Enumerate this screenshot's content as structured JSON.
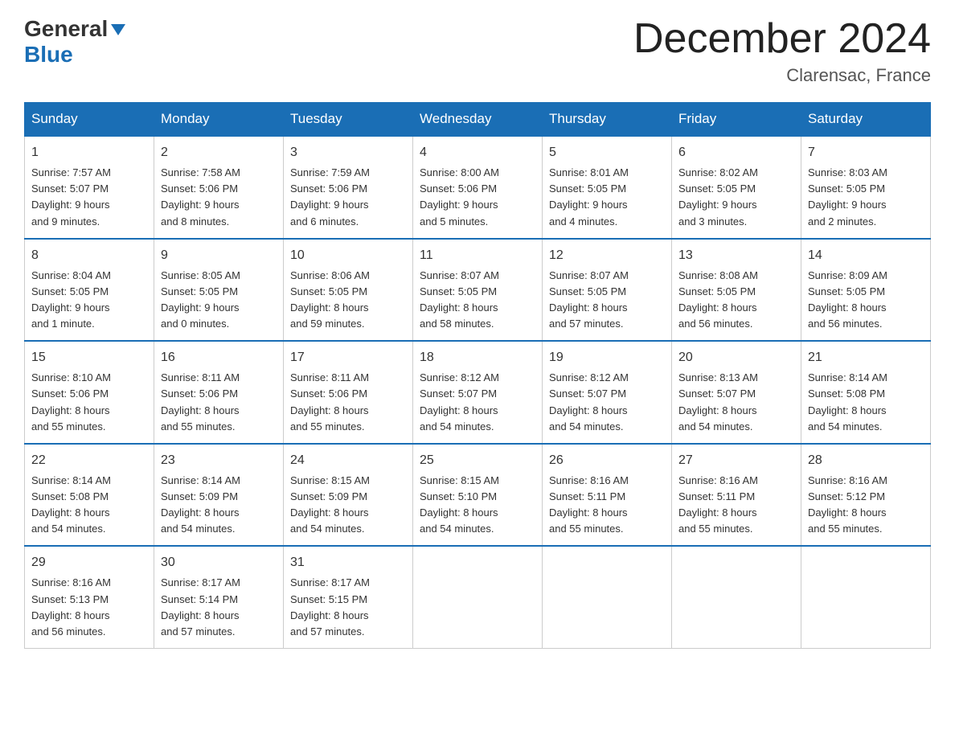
{
  "logo": {
    "general": "General",
    "blue": "Blue",
    "triangle": "▼"
  },
  "title": "December 2024",
  "location": "Clarensac, France",
  "headers": [
    "Sunday",
    "Monday",
    "Tuesday",
    "Wednesday",
    "Thursday",
    "Friday",
    "Saturday"
  ],
  "weeks": [
    [
      {
        "day": "1",
        "info": "Sunrise: 7:57 AM\nSunset: 5:07 PM\nDaylight: 9 hours\nand 9 minutes."
      },
      {
        "day": "2",
        "info": "Sunrise: 7:58 AM\nSunset: 5:06 PM\nDaylight: 9 hours\nand 8 minutes."
      },
      {
        "day": "3",
        "info": "Sunrise: 7:59 AM\nSunset: 5:06 PM\nDaylight: 9 hours\nand 6 minutes."
      },
      {
        "day": "4",
        "info": "Sunrise: 8:00 AM\nSunset: 5:06 PM\nDaylight: 9 hours\nand 5 minutes."
      },
      {
        "day": "5",
        "info": "Sunrise: 8:01 AM\nSunset: 5:05 PM\nDaylight: 9 hours\nand 4 minutes."
      },
      {
        "day": "6",
        "info": "Sunrise: 8:02 AM\nSunset: 5:05 PM\nDaylight: 9 hours\nand 3 minutes."
      },
      {
        "day": "7",
        "info": "Sunrise: 8:03 AM\nSunset: 5:05 PM\nDaylight: 9 hours\nand 2 minutes."
      }
    ],
    [
      {
        "day": "8",
        "info": "Sunrise: 8:04 AM\nSunset: 5:05 PM\nDaylight: 9 hours\nand 1 minute."
      },
      {
        "day": "9",
        "info": "Sunrise: 8:05 AM\nSunset: 5:05 PM\nDaylight: 9 hours\nand 0 minutes."
      },
      {
        "day": "10",
        "info": "Sunrise: 8:06 AM\nSunset: 5:05 PM\nDaylight: 8 hours\nand 59 minutes."
      },
      {
        "day": "11",
        "info": "Sunrise: 8:07 AM\nSunset: 5:05 PM\nDaylight: 8 hours\nand 58 minutes."
      },
      {
        "day": "12",
        "info": "Sunrise: 8:07 AM\nSunset: 5:05 PM\nDaylight: 8 hours\nand 57 minutes."
      },
      {
        "day": "13",
        "info": "Sunrise: 8:08 AM\nSunset: 5:05 PM\nDaylight: 8 hours\nand 56 minutes."
      },
      {
        "day": "14",
        "info": "Sunrise: 8:09 AM\nSunset: 5:05 PM\nDaylight: 8 hours\nand 56 minutes."
      }
    ],
    [
      {
        "day": "15",
        "info": "Sunrise: 8:10 AM\nSunset: 5:06 PM\nDaylight: 8 hours\nand 55 minutes."
      },
      {
        "day": "16",
        "info": "Sunrise: 8:11 AM\nSunset: 5:06 PM\nDaylight: 8 hours\nand 55 minutes."
      },
      {
        "day": "17",
        "info": "Sunrise: 8:11 AM\nSunset: 5:06 PM\nDaylight: 8 hours\nand 55 minutes."
      },
      {
        "day": "18",
        "info": "Sunrise: 8:12 AM\nSunset: 5:07 PM\nDaylight: 8 hours\nand 54 minutes."
      },
      {
        "day": "19",
        "info": "Sunrise: 8:12 AM\nSunset: 5:07 PM\nDaylight: 8 hours\nand 54 minutes."
      },
      {
        "day": "20",
        "info": "Sunrise: 8:13 AM\nSunset: 5:07 PM\nDaylight: 8 hours\nand 54 minutes."
      },
      {
        "day": "21",
        "info": "Sunrise: 8:14 AM\nSunset: 5:08 PM\nDaylight: 8 hours\nand 54 minutes."
      }
    ],
    [
      {
        "day": "22",
        "info": "Sunrise: 8:14 AM\nSunset: 5:08 PM\nDaylight: 8 hours\nand 54 minutes."
      },
      {
        "day": "23",
        "info": "Sunrise: 8:14 AM\nSunset: 5:09 PM\nDaylight: 8 hours\nand 54 minutes."
      },
      {
        "day": "24",
        "info": "Sunrise: 8:15 AM\nSunset: 5:09 PM\nDaylight: 8 hours\nand 54 minutes."
      },
      {
        "day": "25",
        "info": "Sunrise: 8:15 AM\nSunset: 5:10 PM\nDaylight: 8 hours\nand 54 minutes."
      },
      {
        "day": "26",
        "info": "Sunrise: 8:16 AM\nSunset: 5:11 PM\nDaylight: 8 hours\nand 55 minutes."
      },
      {
        "day": "27",
        "info": "Sunrise: 8:16 AM\nSunset: 5:11 PM\nDaylight: 8 hours\nand 55 minutes."
      },
      {
        "day": "28",
        "info": "Sunrise: 8:16 AM\nSunset: 5:12 PM\nDaylight: 8 hours\nand 55 minutes."
      }
    ],
    [
      {
        "day": "29",
        "info": "Sunrise: 8:16 AM\nSunset: 5:13 PM\nDaylight: 8 hours\nand 56 minutes."
      },
      {
        "day": "30",
        "info": "Sunrise: 8:17 AM\nSunset: 5:14 PM\nDaylight: 8 hours\nand 57 minutes."
      },
      {
        "day": "31",
        "info": "Sunrise: 8:17 AM\nSunset: 5:15 PM\nDaylight: 8 hours\nand 57 minutes."
      },
      {
        "day": "",
        "info": ""
      },
      {
        "day": "",
        "info": ""
      },
      {
        "day": "",
        "info": ""
      },
      {
        "day": "",
        "info": ""
      }
    ]
  ]
}
